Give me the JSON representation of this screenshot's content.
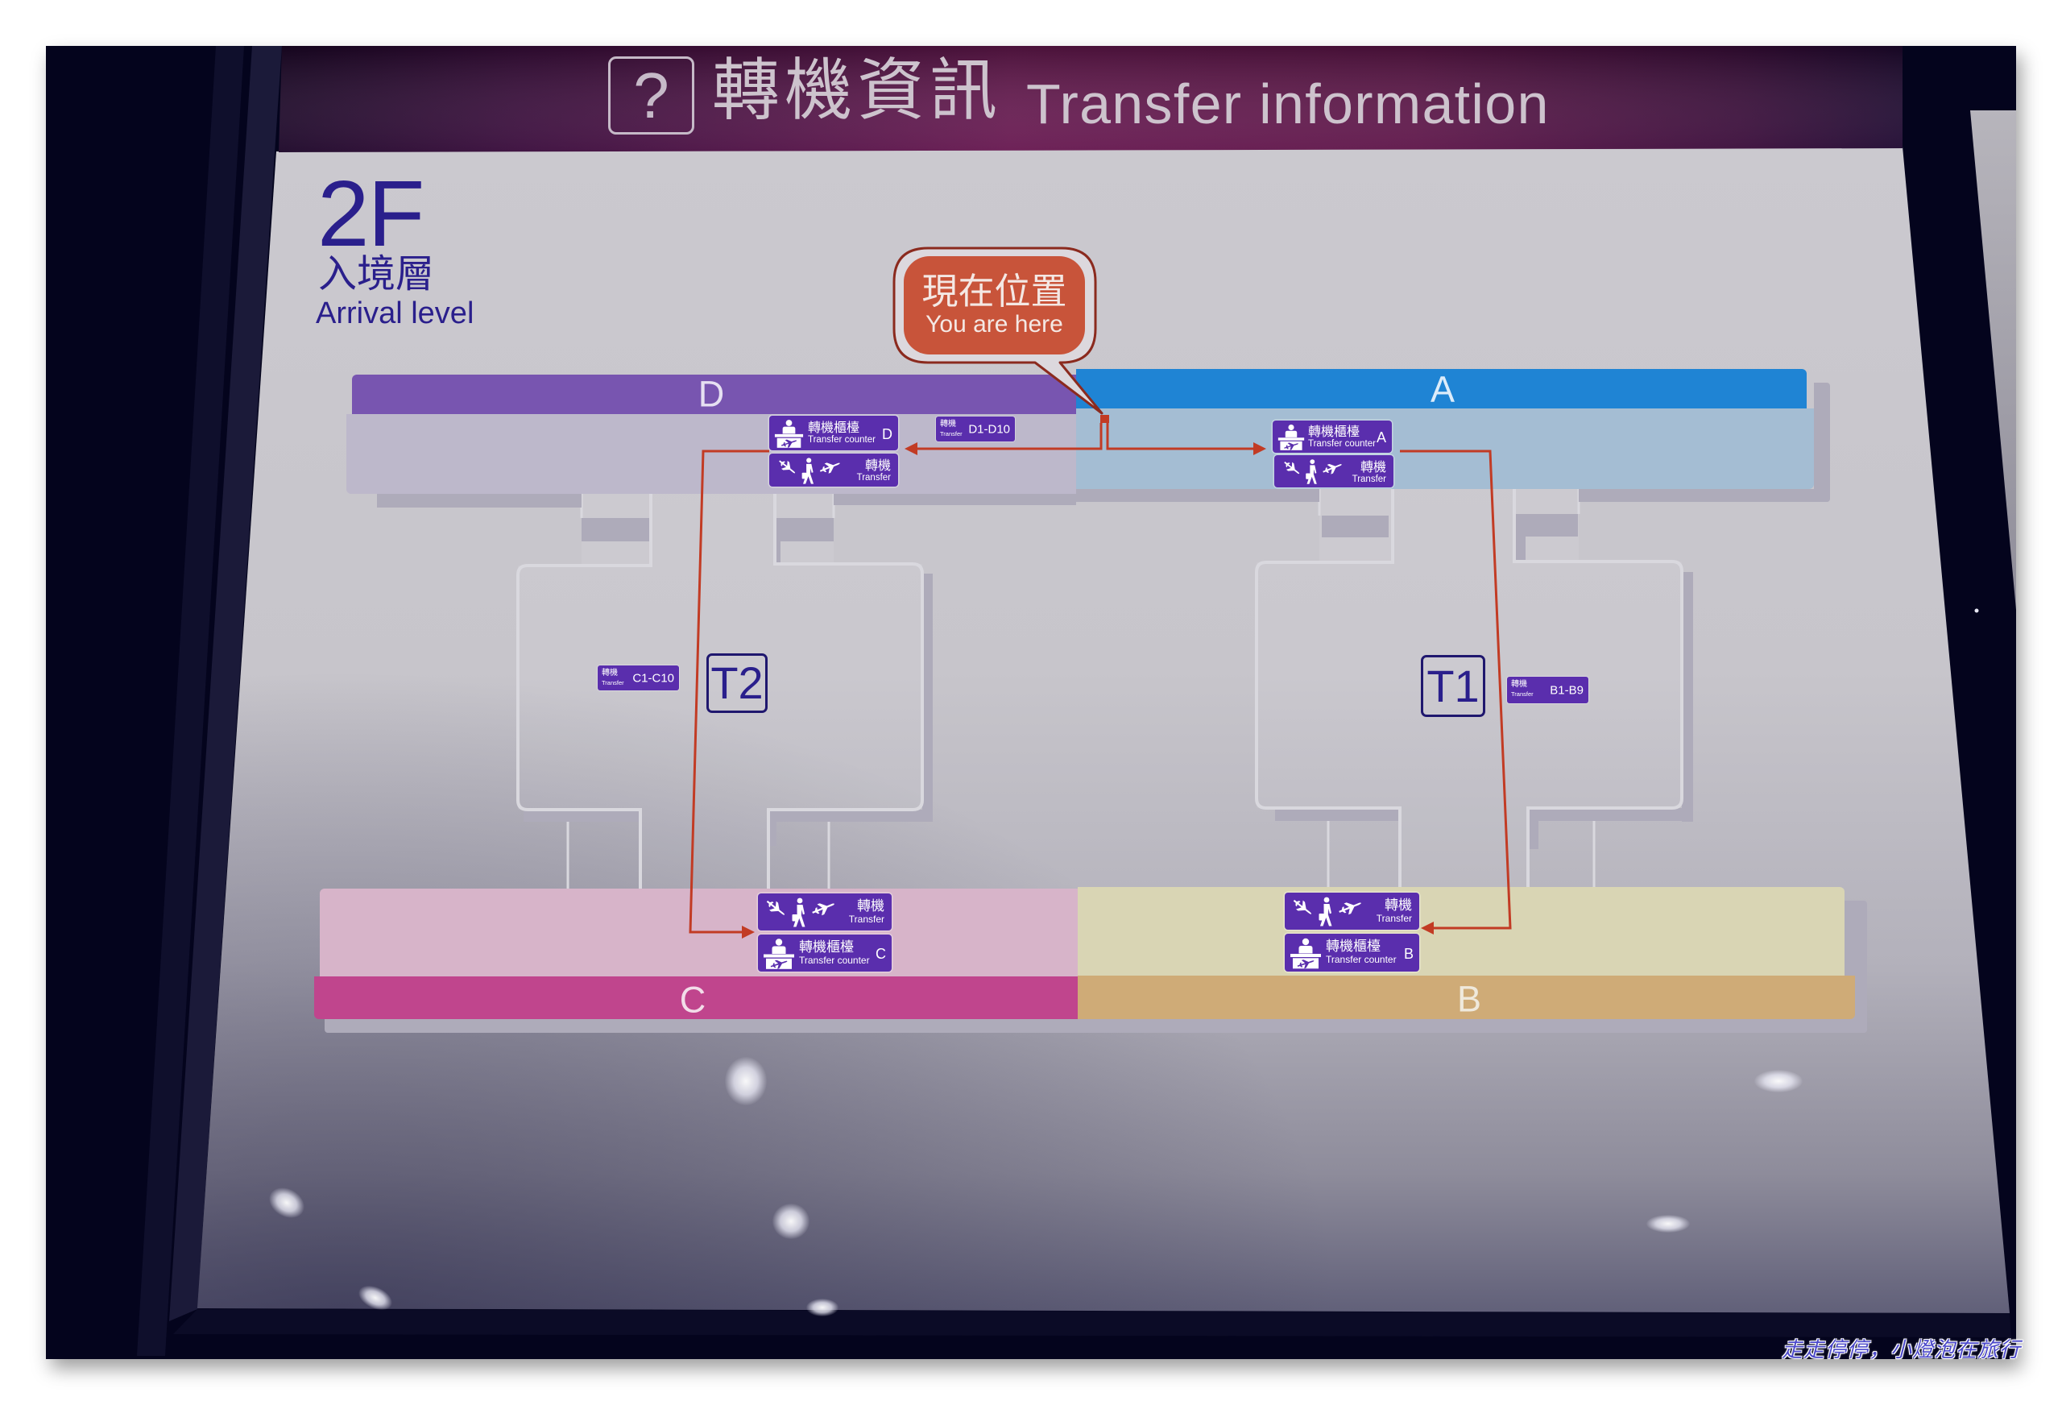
{
  "header": {
    "icon": "question-mark",
    "icon_glyph": "?",
    "title_zh": "轉機資訊",
    "title_en": "Transfer information"
  },
  "floor": {
    "level": "2F",
    "name_zh": "入境層",
    "name_en": "Arrival level"
  },
  "you_are_here": {
    "label_zh": "現在位置",
    "label_en": "You are here"
  },
  "concourses": {
    "D": {
      "label": "D",
      "band_color": "#7855b0",
      "area_color": "#bdb8cb",
      "letter_color": "#e6e0f2"
    },
    "A": {
      "label": "A",
      "band_color": "#1f84d4",
      "area_color": "#a4bdd3",
      "letter_color": "#dcecfa"
    },
    "C": {
      "label": "C",
      "band_color": "#c0458d",
      "area_color": "#d7b4c9",
      "letter_color": "#f2dde9"
    },
    "B": {
      "label": "B",
      "band_color": "#cfab77",
      "area_color": "#d9d5b4",
      "letter_color": "#efe9dc"
    }
  },
  "transfer_counters": [
    {
      "concourse": "D",
      "zh": "轉機櫃檯",
      "en": "Transfer counter",
      "letter": "D"
    },
    {
      "concourse": "A",
      "zh": "轉機櫃檯",
      "en": "Transfer counter",
      "letter": "A"
    },
    {
      "concourse": "C",
      "zh": "轉機櫃檯",
      "en": "Transfer counter",
      "letter": "C"
    },
    {
      "concourse": "B",
      "zh": "轉機櫃檯",
      "en": "Transfer counter",
      "letter": "B"
    }
  ],
  "transfer_signs": [
    {
      "concourse": "D",
      "zh": "轉機",
      "en": "Transfer"
    },
    {
      "concourse": "A",
      "zh": "轉機",
      "en": "Transfer"
    },
    {
      "concourse": "C",
      "zh": "轉機",
      "en": "Transfer"
    },
    {
      "concourse": "B",
      "zh": "轉機",
      "en": "Transfer"
    }
  ],
  "gate_badges": [
    {
      "zh": "轉機",
      "en": "Transfer",
      "gates": "D1-D10"
    },
    {
      "zh": "轉機",
      "en": "Transfer",
      "gates": "C1-C10"
    },
    {
      "zh": "轉機",
      "en": "Transfer",
      "gates": "B1-B9"
    }
  ],
  "terminals": [
    {
      "label": "T2"
    },
    {
      "label": "T1"
    }
  ],
  "watermark": "走走停停，小燈泡在旅行",
  "colors": {
    "sign_purple": "#5a2ead",
    "route_red": "#c23b24",
    "callout_red": "#c8543a",
    "header_magenta": "#671850",
    "navy_text": "#2a1f8c"
  }
}
